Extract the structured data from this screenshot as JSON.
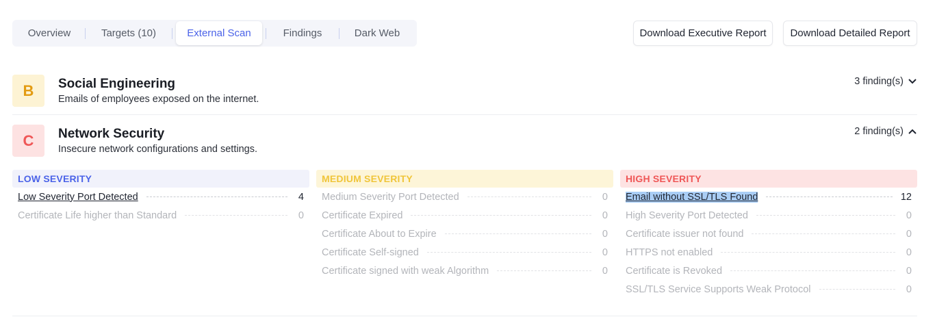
{
  "tabs": [
    {
      "label": "Overview"
    },
    {
      "label": "Targets (10)"
    },
    {
      "label": "External Scan"
    },
    {
      "label": "Findings"
    },
    {
      "label": "Dark Web"
    }
  ],
  "buttons": {
    "exec": "Download Executive Report",
    "detail": "Download Detailed Report"
  },
  "sections": [
    {
      "grade": "B",
      "title": "Social Engineering",
      "desc": "Emails of employees exposed on the internet.",
      "count": "3 finding(s)",
      "expanded": false
    },
    {
      "grade": "C",
      "title": "Network Security",
      "desc": "Insecure network configurations and settings.",
      "count": "2 finding(s)",
      "expanded": true
    }
  ],
  "colors": {
    "low": "#4b63e8",
    "medium": "#f0c53a",
    "high": "#ef5757",
    "gradeB": "#e39b12",
    "gradeC": "#ef5757"
  },
  "severity": {
    "low": {
      "title": "LOW SEVERITY",
      "items": [
        {
          "label": "Low Severity Port Detected",
          "value": "4"
        },
        {
          "label": "Certificate Life higher than Standard",
          "value": "0"
        }
      ]
    },
    "medium": {
      "title": "MEDIUM SEVERITY",
      "items": [
        {
          "label": "Medium Severity Port Detected",
          "value": "0"
        },
        {
          "label": "Certificate Expired",
          "value": "0"
        },
        {
          "label": "Certificate About to Expire",
          "value": "0"
        },
        {
          "label": "Certificate Self-signed",
          "value": "0"
        },
        {
          "label": "Certificate signed with weak Algorithm",
          "value": "0"
        }
      ]
    },
    "high": {
      "title": "HIGH SEVERITY",
      "items": [
        {
          "label": "Email without SSL/TLS Found",
          "value": "12"
        },
        {
          "label": "High Severity Port Detected",
          "value": "0"
        },
        {
          "label": "Certificate issuer not found",
          "value": "0"
        },
        {
          "label": "HTTPS not enabled",
          "value": "0"
        },
        {
          "label": "Certificate is Revoked",
          "value": "0"
        },
        {
          "label": "SSL/TLS Service Supports Weak Protocol",
          "value": "0"
        }
      ]
    }
  }
}
